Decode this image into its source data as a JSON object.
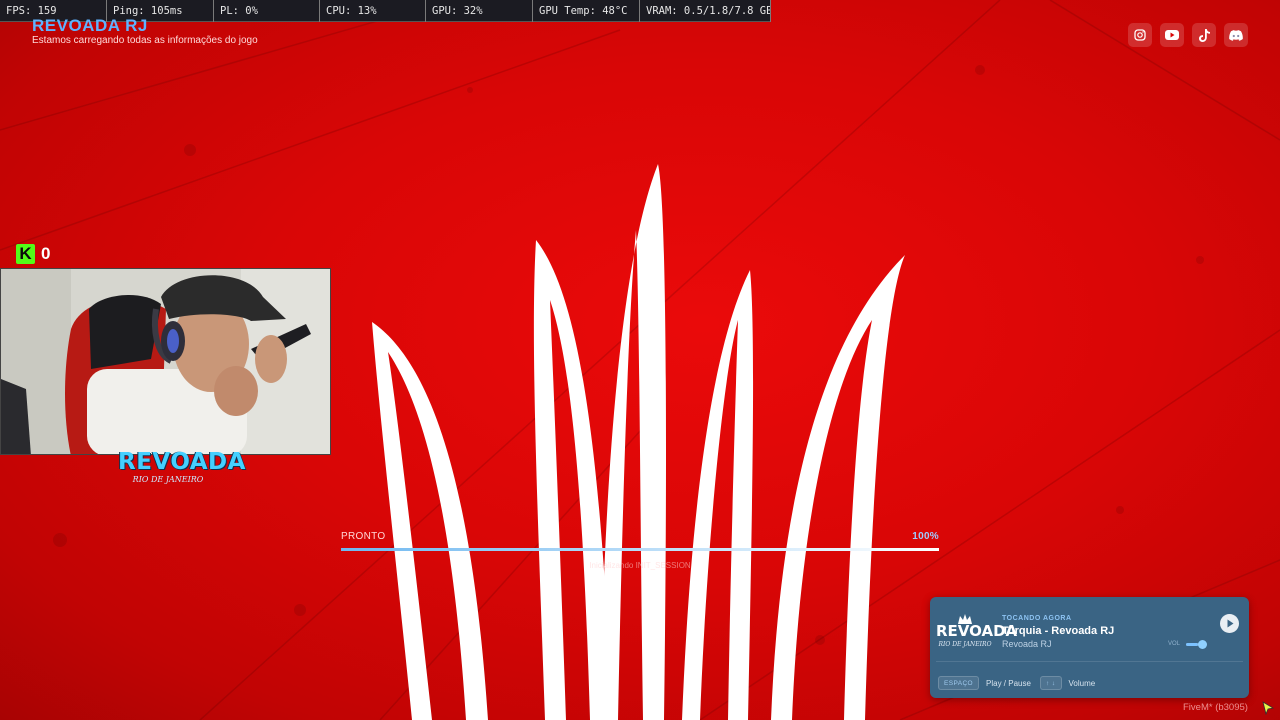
{
  "perf_overlay": {
    "fps": "FPS: 159",
    "ping": "Ping: 105ms",
    "packet_loss": "PL: 0%",
    "cpu": "CPU: 13%",
    "gpu": "GPU: 32%",
    "gpu_temp": "GPU Temp: 48°C",
    "vram": "VRAM: 0.5/1.8/7.8 GB"
  },
  "server": {
    "title": "REVOADA RJ",
    "subtitle": "Estamos carregando todas as informações do jogo"
  },
  "socials": [
    {
      "icon": "instagram-icon"
    },
    {
      "icon": "youtube-icon"
    },
    {
      "icon": "tiktok-icon"
    },
    {
      "icon": "discord-icon"
    }
  ],
  "kick": {
    "icon": "kick-logo",
    "letter": "K",
    "count": "0"
  },
  "streamer_logo": {
    "text": "REVOADA",
    "subtext": "RIO DE JANEIRO"
  },
  "loading": {
    "label": "PRONTO",
    "percent_text": "100%",
    "progress": 1.0,
    "status": "Inicializando INIT_SESSION"
  },
  "player": {
    "logo_text": "REVOADA",
    "logo_subtext": "RIO DE JANEIRO",
    "now_playing_label": "TOCANDO AGORA",
    "track_title": "Turquia - Revoada RJ",
    "track_artist": "Revoada RJ",
    "volume_label": "VOL",
    "volume_level": 0.6,
    "hints": [
      {
        "key": "ESPAÇO",
        "action": "Play / Pause"
      },
      {
        "key": "↑ ↓",
        "action": "Volume"
      }
    ]
  },
  "build_info": "FiveM* (b3095)",
  "colors": {
    "background": "#d90606",
    "accent_blue": "#5fb2ff",
    "player_bg": "#3a6484",
    "kick_green": "#53fc18"
  }
}
